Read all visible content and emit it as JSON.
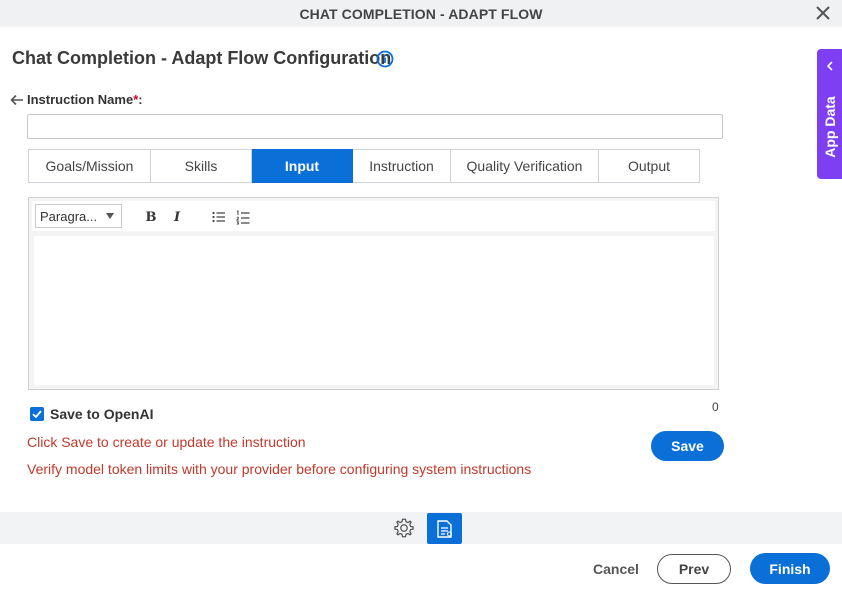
{
  "window": {
    "title": "CHAT COMPLETION - ADAPT FLOW"
  },
  "page": {
    "title": "Chat Completion - Adapt Flow Configuration"
  },
  "form": {
    "instruction_label": "Instruction Name",
    "required_mark": "*",
    "label_suffix": ":",
    "instruction_value": "",
    "instruction_placeholder": ""
  },
  "tabs": [
    {
      "label": "Goals/Mission",
      "active": false
    },
    {
      "label": "Skills",
      "active": false
    },
    {
      "label": "Input",
      "active": true
    },
    {
      "label": "Instruction",
      "active": false
    },
    {
      "label": "Quality Verification",
      "active": false
    },
    {
      "label": "Output",
      "active": false
    }
  ],
  "editor": {
    "paragraph_select": "Paragra...",
    "bold": "B",
    "italic": "I",
    "char_count": "0"
  },
  "save_openai": {
    "label": "Save to OpenAI",
    "checked": true
  },
  "messages": {
    "save_hint": "Click Save to create or update the instruction",
    "token_hint": "Verify model token limits with your provider before configuring system instructions"
  },
  "buttons": {
    "save": "Save",
    "cancel": "Cancel",
    "prev": "Prev",
    "finish": "Finish"
  },
  "side_panel": {
    "label": "App Data"
  },
  "icons": [
    "close-icon",
    "info-icon",
    "back-arrow-icon",
    "bullet-list-icon",
    "numbered-list-icon",
    "gear-icon",
    "document-icon",
    "chevron-left-icon"
  ],
  "colors": {
    "accent": "#0a6fd6",
    "side_panel": "#7e3ff2",
    "error_text": "#c0392b",
    "required": "#d0021b"
  }
}
